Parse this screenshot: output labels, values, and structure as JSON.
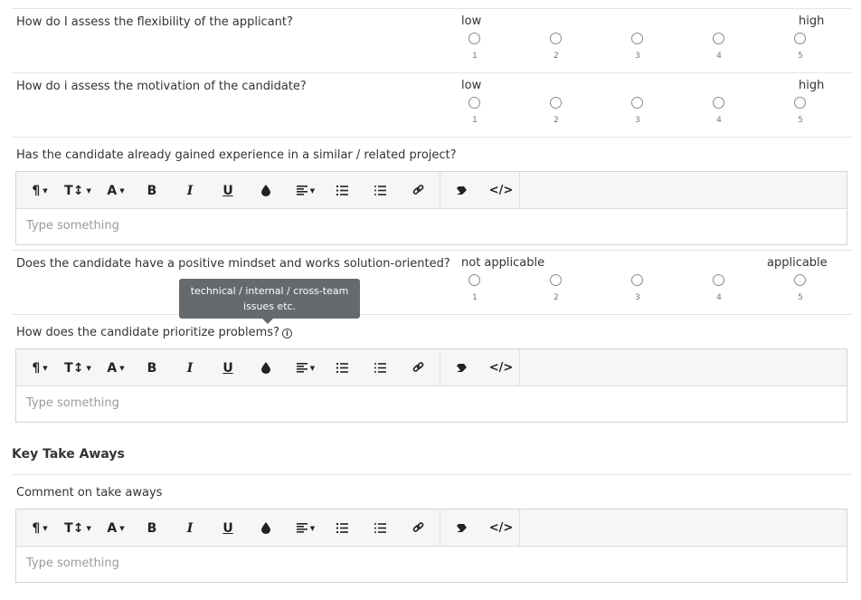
{
  "rating_questions": [
    {
      "question": "How do I assess the flexibility of the applicant?",
      "low": "low",
      "high": "high",
      "scale": [
        "1",
        "2",
        "3",
        "4",
        "5"
      ]
    },
    {
      "question": "How do i assess the motivation of the candidate?",
      "low": "low",
      "high": "high",
      "scale": [
        "1",
        "2",
        "3",
        "4",
        "5"
      ]
    },
    {
      "question": "Does the candidate have a positive mindset and works solution-oriented?",
      "low": "not applicable",
      "high": "applicable",
      "scale": [
        "1",
        "2",
        "3",
        "4",
        "5"
      ]
    }
  ],
  "text_questions": [
    {
      "question": "Has the candidate already gained experience in a similar / related project?",
      "placeholder": "Type something"
    },
    {
      "question": "How does the candidate prioritize problems?",
      "placeholder": "Type something",
      "info_icon": "info-icon"
    }
  ],
  "tooltip": {
    "text_line1": "technical / internal / cross-team",
    "text_line2": "issues etc."
  },
  "takeaways": {
    "section_title": "Key Take Aways",
    "question": "Comment on take aways",
    "placeholder": "Type something"
  },
  "toolbar_icons": [
    "paragraph-icon",
    "font-size-icon",
    "font-family-icon",
    "bold-icon",
    "italic-icon",
    "underline-icon",
    "color-icon",
    "align-icon",
    "ordered-list-icon",
    "unordered-list-icon",
    "link-icon",
    "eraser-icon",
    "code-view-icon"
  ]
}
